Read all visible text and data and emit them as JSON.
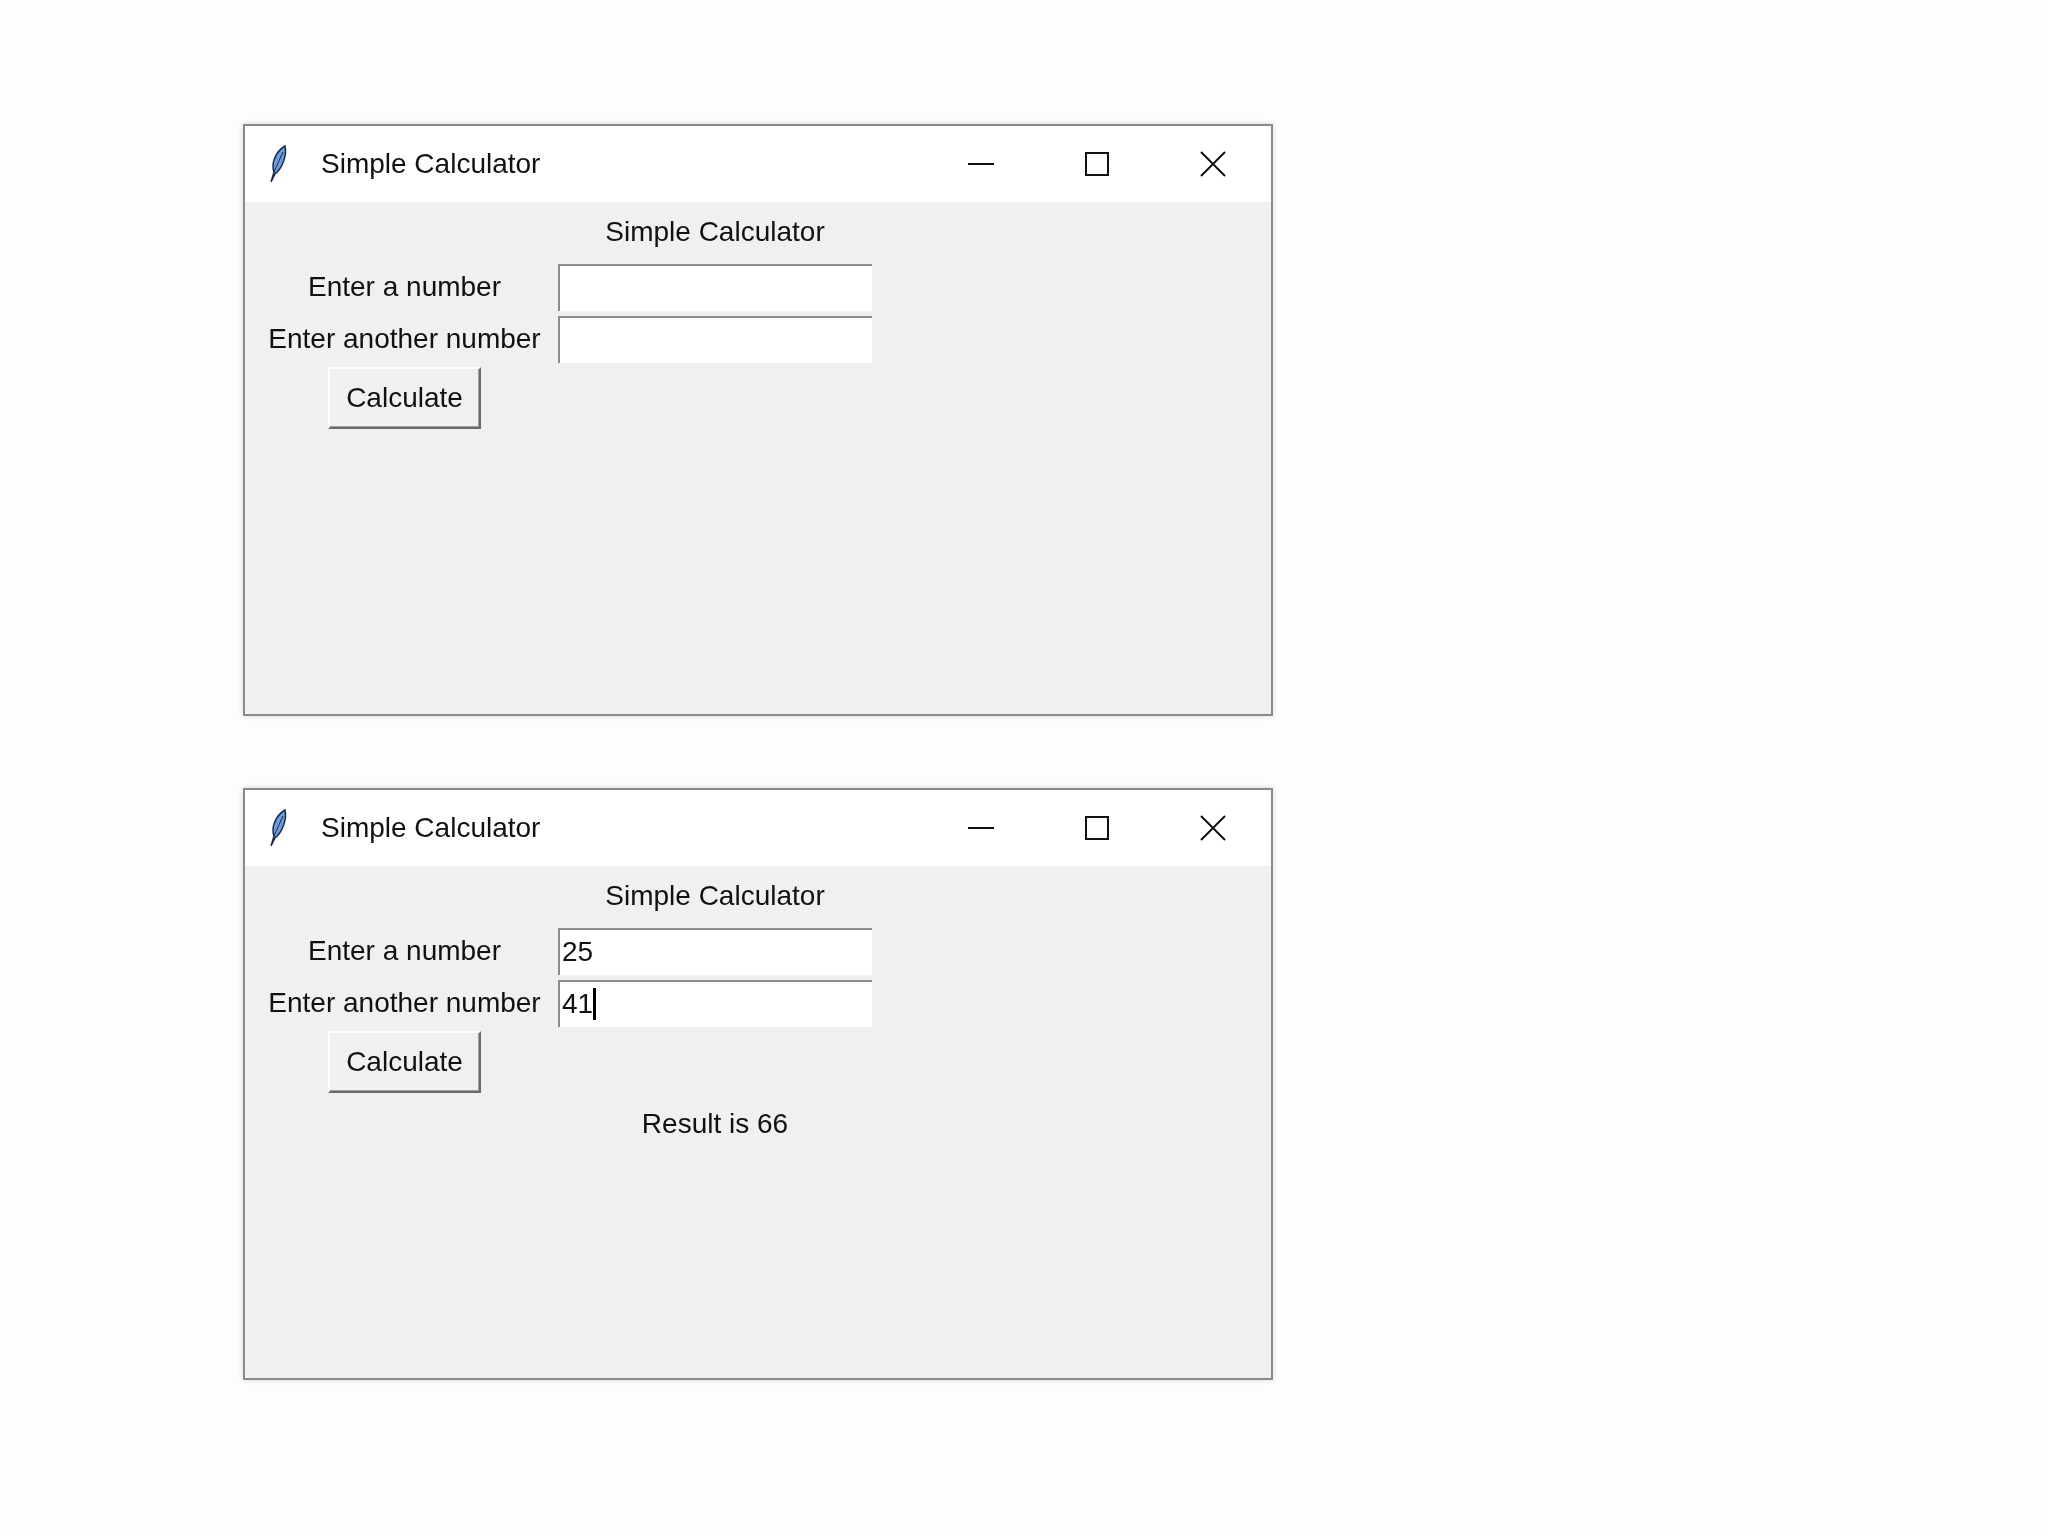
{
  "windows": [
    {
      "title": "Simple Calculator",
      "heading": "Simple Calculator",
      "fields": [
        {
          "label": "Enter a number",
          "caret": false
        },
        {
          "label": "Enter another number",
          "caret": false
        }
      ],
      "button": "Calculate"
    },
    {
      "title": "Simple Calculator",
      "heading": "Simple Calculator",
      "fields": [
        {
          "label": "Enter a number",
          "value": "25",
          "caret": false
        },
        {
          "label": "Enter another number",
          "value": "41",
          "caret": true
        }
      ],
      "button": "Calculate",
      "result": "Result is 66"
    }
  ]
}
